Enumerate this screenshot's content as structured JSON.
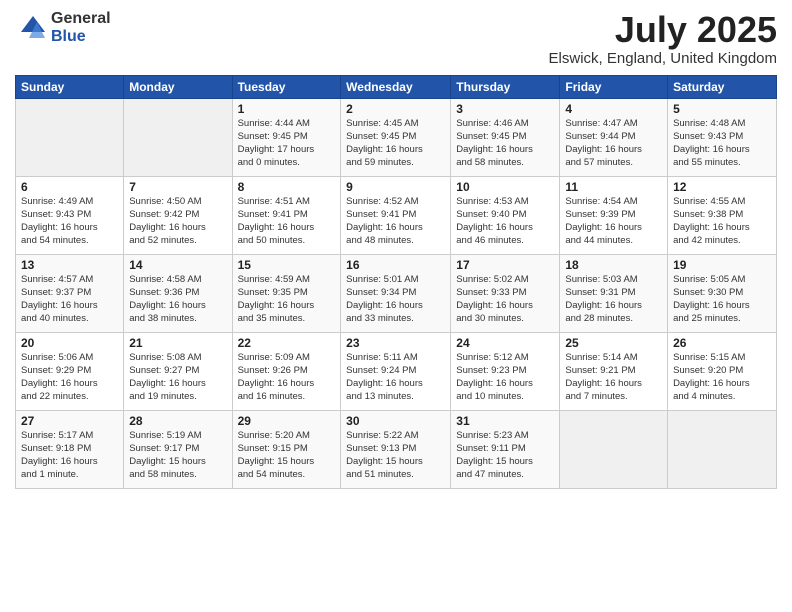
{
  "logo": {
    "general": "General",
    "blue": "Blue"
  },
  "title": "July 2025",
  "subtitle": "Elswick, England, United Kingdom",
  "days_header": [
    "Sunday",
    "Monday",
    "Tuesday",
    "Wednesday",
    "Thursday",
    "Friday",
    "Saturday"
  ],
  "weeks": [
    [
      {
        "num": "",
        "detail": ""
      },
      {
        "num": "",
        "detail": ""
      },
      {
        "num": "1",
        "detail": "Sunrise: 4:44 AM\nSunset: 9:45 PM\nDaylight: 17 hours\nand 0 minutes."
      },
      {
        "num": "2",
        "detail": "Sunrise: 4:45 AM\nSunset: 9:45 PM\nDaylight: 16 hours\nand 59 minutes."
      },
      {
        "num": "3",
        "detail": "Sunrise: 4:46 AM\nSunset: 9:45 PM\nDaylight: 16 hours\nand 58 minutes."
      },
      {
        "num": "4",
        "detail": "Sunrise: 4:47 AM\nSunset: 9:44 PM\nDaylight: 16 hours\nand 57 minutes."
      },
      {
        "num": "5",
        "detail": "Sunrise: 4:48 AM\nSunset: 9:43 PM\nDaylight: 16 hours\nand 55 minutes."
      }
    ],
    [
      {
        "num": "6",
        "detail": "Sunrise: 4:49 AM\nSunset: 9:43 PM\nDaylight: 16 hours\nand 54 minutes."
      },
      {
        "num": "7",
        "detail": "Sunrise: 4:50 AM\nSunset: 9:42 PM\nDaylight: 16 hours\nand 52 minutes."
      },
      {
        "num": "8",
        "detail": "Sunrise: 4:51 AM\nSunset: 9:41 PM\nDaylight: 16 hours\nand 50 minutes."
      },
      {
        "num": "9",
        "detail": "Sunrise: 4:52 AM\nSunset: 9:41 PM\nDaylight: 16 hours\nand 48 minutes."
      },
      {
        "num": "10",
        "detail": "Sunrise: 4:53 AM\nSunset: 9:40 PM\nDaylight: 16 hours\nand 46 minutes."
      },
      {
        "num": "11",
        "detail": "Sunrise: 4:54 AM\nSunset: 9:39 PM\nDaylight: 16 hours\nand 44 minutes."
      },
      {
        "num": "12",
        "detail": "Sunrise: 4:55 AM\nSunset: 9:38 PM\nDaylight: 16 hours\nand 42 minutes."
      }
    ],
    [
      {
        "num": "13",
        "detail": "Sunrise: 4:57 AM\nSunset: 9:37 PM\nDaylight: 16 hours\nand 40 minutes."
      },
      {
        "num": "14",
        "detail": "Sunrise: 4:58 AM\nSunset: 9:36 PM\nDaylight: 16 hours\nand 38 minutes."
      },
      {
        "num": "15",
        "detail": "Sunrise: 4:59 AM\nSunset: 9:35 PM\nDaylight: 16 hours\nand 35 minutes."
      },
      {
        "num": "16",
        "detail": "Sunrise: 5:01 AM\nSunset: 9:34 PM\nDaylight: 16 hours\nand 33 minutes."
      },
      {
        "num": "17",
        "detail": "Sunrise: 5:02 AM\nSunset: 9:33 PM\nDaylight: 16 hours\nand 30 minutes."
      },
      {
        "num": "18",
        "detail": "Sunrise: 5:03 AM\nSunset: 9:31 PM\nDaylight: 16 hours\nand 28 minutes."
      },
      {
        "num": "19",
        "detail": "Sunrise: 5:05 AM\nSunset: 9:30 PM\nDaylight: 16 hours\nand 25 minutes."
      }
    ],
    [
      {
        "num": "20",
        "detail": "Sunrise: 5:06 AM\nSunset: 9:29 PM\nDaylight: 16 hours\nand 22 minutes."
      },
      {
        "num": "21",
        "detail": "Sunrise: 5:08 AM\nSunset: 9:27 PM\nDaylight: 16 hours\nand 19 minutes."
      },
      {
        "num": "22",
        "detail": "Sunrise: 5:09 AM\nSunset: 9:26 PM\nDaylight: 16 hours\nand 16 minutes."
      },
      {
        "num": "23",
        "detail": "Sunrise: 5:11 AM\nSunset: 9:24 PM\nDaylight: 16 hours\nand 13 minutes."
      },
      {
        "num": "24",
        "detail": "Sunrise: 5:12 AM\nSunset: 9:23 PM\nDaylight: 16 hours\nand 10 minutes."
      },
      {
        "num": "25",
        "detail": "Sunrise: 5:14 AM\nSunset: 9:21 PM\nDaylight: 16 hours\nand 7 minutes."
      },
      {
        "num": "26",
        "detail": "Sunrise: 5:15 AM\nSunset: 9:20 PM\nDaylight: 16 hours\nand 4 minutes."
      }
    ],
    [
      {
        "num": "27",
        "detail": "Sunrise: 5:17 AM\nSunset: 9:18 PM\nDaylight: 16 hours\nand 1 minute."
      },
      {
        "num": "28",
        "detail": "Sunrise: 5:19 AM\nSunset: 9:17 PM\nDaylight: 15 hours\nand 58 minutes."
      },
      {
        "num": "29",
        "detail": "Sunrise: 5:20 AM\nSunset: 9:15 PM\nDaylight: 15 hours\nand 54 minutes."
      },
      {
        "num": "30",
        "detail": "Sunrise: 5:22 AM\nSunset: 9:13 PM\nDaylight: 15 hours\nand 51 minutes."
      },
      {
        "num": "31",
        "detail": "Sunrise: 5:23 AM\nSunset: 9:11 PM\nDaylight: 15 hours\nand 47 minutes."
      },
      {
        "num": "",
        "detail": ""
      },
      {
        "num": "",
        "detail": ""
      }
    ]
  ]
}
